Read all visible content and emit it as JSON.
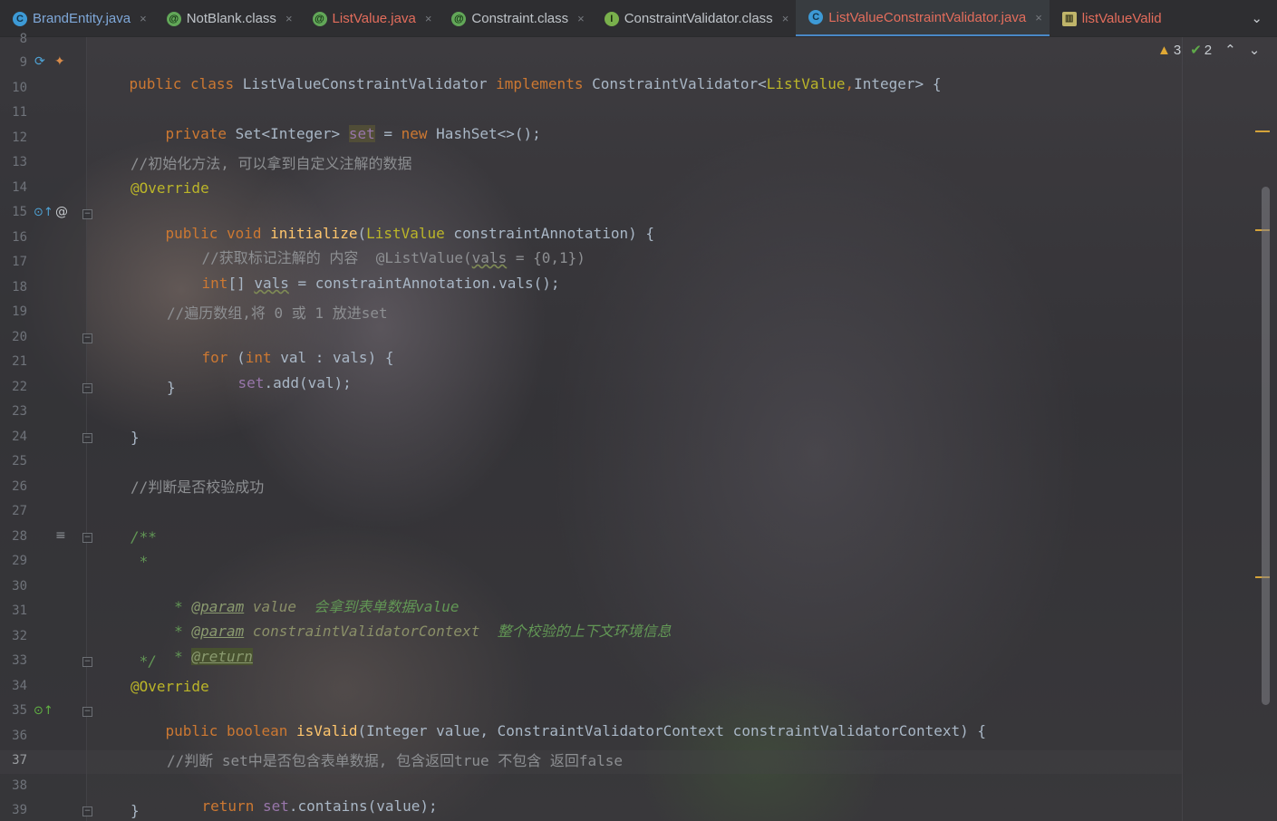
{
  "tabs": [
    {
      "label": "BrandEntity.java",
      "icon": "class-icon",
      "icon_glyph": "C",
      "style": "java"
    },
    {
      "label": "NotBlank.class",
      "icon": "annotation-icon",
      "icon_glyph": "@",
      "style": "plain"
    },
    {
      "label": "ListValue.java",
      "icon": "annotation-icon",
      "icon_glyph": "@",
      "style": "err"
    },
    {
      "label": "Constraint.class",
      "icon": "annotation-icon",
      "icon_glyph": "@",
      "style": "plain"
    },
    {
      "label": "ConstraintValidator.class",
      "icon": "interface-icon",
      "icon_glyph": "I",
      "style": "plain"
    },
    {
      "label": "ListValueConstraintValidator.java",
      "icon": "class-icon",
      "icon_glyph": "C",
      "style": "active"
    },
    {
      "label": "listValueValid",
      "icon": "resource-bundle-icon",
      "icon_glyph": "▥",
      "style": "partial"
    }
  ],
  "tab_close_glyph": "×",
  "tab_overflow_glyph": "⌄",
  "inspections": {
    "warnings": "3",
    "weak_warnings": "2",
    "warn_glyph": "▲",
    "ok_glyph": "✔",
    "up_glyph": "⌃",
    "down_glyph": "⌄"
  },
  "line_numbers": [
    "8",
    "9",
    "10",
    "11",
    "12",
    "13",
    "14",
    "15",
    "16",
    "17",
    "18",
    "19",
    "20",
    "21",
    "22",
    "23",
    "24",
    "25",
    "26",
    "27",
    "28",
    "29",
    "30",
    "31",
    "32",
    "33",
    "34",
    "35",
    "36",
    "37",
    "38",
    "39"
  ],
  "current_line": "37",
  "gutter_glyphs": {
    "implement": "⟳",
    "override": "⊙↑",
    "at": "@",
    "doc": "≡",
    "fold_open": "⊟",
    "fold_close": "⊟"
  },
  "code": {
    "l9": [
      "public class ",
      "ListValueConstraintValidator ",
      "implements ",
      "ConstraintValidator",
      "<",
      "ListValue",
      ",",
      "Integer",
      "> {"
    ],
    "l11": [
      "private ",
      "Set<Integer> ",
      "set",
      " = ",
      "new ",
      "HashSet<>();"
    ],
    "l13": "//初始化方法, 可以拿到自定义注解的数据",
    "l14": "@Override",
    "l15": [
      "public void ",
      "initialize",
      "(",
      "ListValue",
      " constraintAnnotation) {"
    ],
    "l16": [
      "//获取标记注解的 内容  @ListValue(",
      "vals",
      " = {0,1})"
    ],
    "l17": [
      "int",
      "[] ",
      "vals",
      " = constraintAnnotation.vals();"
    ],
    "l19": "//遍历数组,将 0 或 1 放进set",
    "l20": [
      "for ",
      "(",
      "int ",
      "val : vals) {"
    ],
    "l21": [
      "set",
      ".add(val);"
    ],
    "l22": "}",
    "l24": "}",
    "l26": "//判断是否校验成功",
    "l28": "/**",
    "l29": " *",
    "l30": [
      " * ",
      "@param",
      " value  ",
      "会拿到表单数据value"
    ],
    "l31": [
      " * ",
      "@param",
      " constraintValidatorContext  ",
      "整个校验的上下文环境信息"
    ],
    "l32": [
      " * ",
      "@return"
    ],
    "l33": " */",
    "l34": "@Override",
    "l35": [
      "public boolean ",
      "isValid",
      "(Integer value, ",
      "ConstraintValidatorContext constraintValidatorContext) {"
    ],
    "l37": "//判断 set中是否包含表单数据, 包含返回true 不包含 返回false",
    "l38": [
      "return ",
      "set",
      ".contains(value);"
    ],
    "l39": "}"
  }
}
